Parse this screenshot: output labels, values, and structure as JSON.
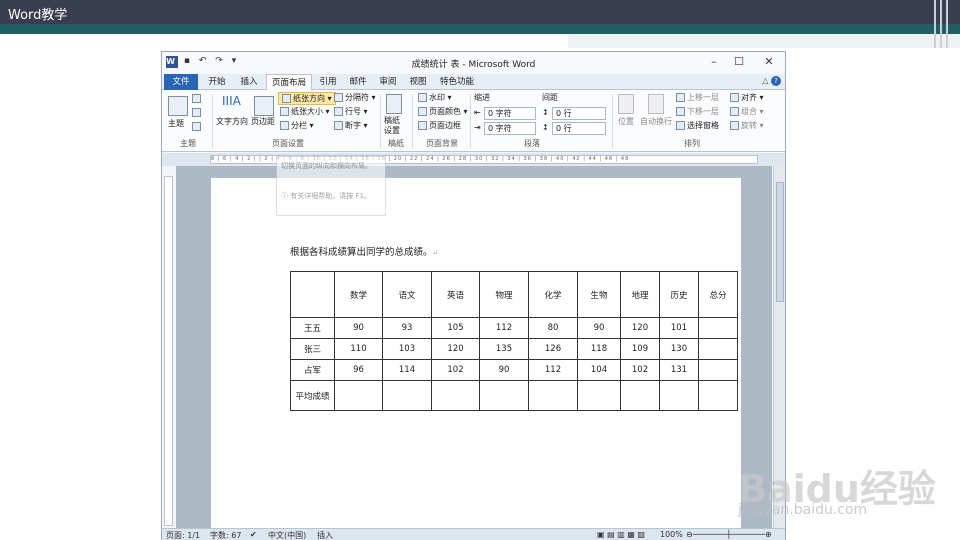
{
  "slide": {
    "title": "Word教学"
  },
  "window": {
    "title": "成绩统计 表 - Microsoft Word",
    "controls": {
      "minimize": "–",
      "maximize": "☐",
      "close": "✕"
    }
  },
  "tabs": [
    "文件",
    "开始",
    "插入",
    "页面布局",
    "引用",
    "邮件",
    "审阅",
    "视图",
    "特色功能"
  ],
  "ribbon": {
    "theme": {
      "button": "主题",
      "group": "主题"
    },
    "page_setup": {
      "text_direction": "文字方向",
      "margins": "页边距",
      "orientation": "纸张方向",
      "size": "纸张大小",
      "columns": "分栏",
      "breaks": "分隔符",
      "line_numbers": "行号",
      "hyphenation": "断字",
      "group": "页面设置"
    },
    "draft": {
      "button": "稿纸设置",
      "group": "稿纸"
    },
    "background": {
      "watermark": "水印",
      "page_color": "页面颜色",
      "page_borders": "页面边框",
      "group": "页面背景"
    },
    "paragraph": {
      "indent": "缩进",
      "spacing": "间距",
      "indent_left": "0 字符",
      "indent_right": "0 字符",
      "space_before": "0 行",
      "space_after": "0 行",
      "group": "段落"
    },
    "arrange": {
      "position": "位置",
      "wrap": "自动换行",
      "forward": "上移一层",
      "backward": "下移一层",
      "selection": "选择窗格",
      "align": "对齐",
      "group_btn": "组合",
      "rotate": "旋转",
      "group": "排列"
    }
  },
  "tooltip": {
    "desc": "切换页面的纵向和横向布局。",
    "help": "有关详细帮助，请按 F1。"
  },
  "document": {
    "heading": "根据各科成绩算出同学的总成绩。",
    "table": {
      "headers": [
        "",
        "数学",
        "语文",
        "英语",
        "物理",
        "化学",
        "生物",
        "地理",
        "历史",
        "总分"
      ],
      "rows": [
        [
          "王五",
          "90",
          "93",
          "105",
          "112",
          "80",
          "90",
          "120",
          "101",
          ""
        ],
        [
          "张三",
          "110",
          "103",
          "120",
          "135",
          "126",
          "118",
          "109",
          "130",
          ""
        ],
        [
          "占军",
          "96",
          "114",
          "102",
          "90",
          "112",
          "104",
          "102",
          "131",
          ""
        ],
        [
          "平均成绩",
          "",
          "",
          "",
          "",
          "",
          "",
          "",
          "",
          ""
        ]
      ]
    }
  },
  "status": {
    "page": "页面: 1/1",
    "words": "字数: 67",
    "language": "中文(中国)",
    "mode": "插入",
    "zoom": "100%"
  },
  "watermark": {
    "logo": "Baidu经验",
    "url": "jingyan.baidu.com"
  }
}
